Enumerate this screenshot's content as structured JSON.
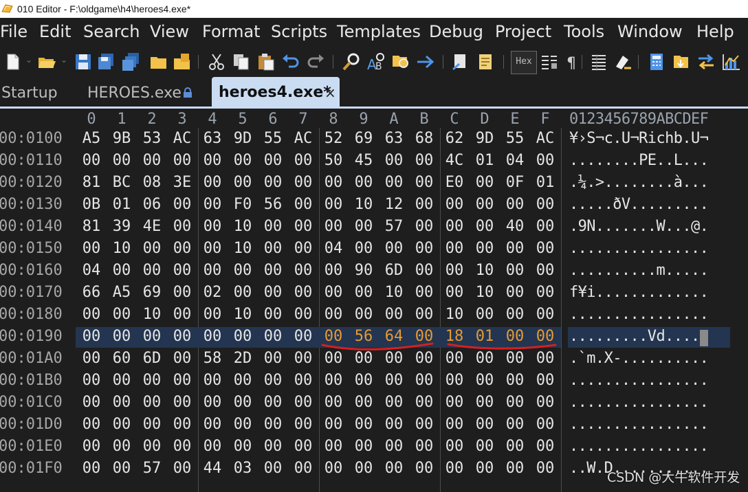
{
  "window": {
    "title": "010 Editor - F:\\oldgame\\h4\\heroes4.exe*"
  },
  "menu": [
    "File",
    "Edit",
    "Search",
    "View",
    "Format",
    "Scripts",
    "Templates",
    "Debug",
    "Project",
    "Tools",
    "Window",
    "Help"
  ],
  "toolbar": {
    "icons": [
      "new-file-icon",
      "open-folder-icon",
      "save-icon",
      "save-as-icon",
      "save-all-icon",
      "open-folder-icon",
      "close-icon",
      "cut-icon",
      "copy-icon",
      "paste-icon",
      "undo-icon",
      "redo-icon",
      "find-icon",
      "replace-icon",
      "find-in-files-icon",
      "goto-icon",
      "compare-icon",
      "notes-icon",
      "hex-mode-icon",
      "binary-view-icon",
      "paragraph-icon",
      "columns-icon",
      "highlight-icon",
      "calculator-icon",
      "inspector-icon",
      "swap-icon",
      "histogram-icon"
    ],
    "hex_label": "Hex"
  },
  "tabs": [
    {
      "label": "Startup",
      "active": false
    },
    {
      "label": "HEROES.exe",
      "active": false,
      "locked": true
    },
    {
      "label": "heroes4.exe*",
      "active": true,
      "close": "×"
    }
  ],
  "hex": {
    "columns": [
      "0",
      "1",
      "2",
      "3",
      "4",
      "5",
      "6",
      "7",
      "8",
      "9",
      "A",
      "B",
      "C",
      "D",
      "E",
      "F"
    ],
    "ascii_header": "0123456789ABCDEF",
    "selected_row": "00:0190",
    "rows": [
      {
        "addr": "00:0100",
        "bytes": [
          "A5",
          "9B",
          "53",
          "AC",
          "63",
          "9D",
          "55",
          "AC",
          "52",
          "69",
          "63",
          "68",
          "62",
          "9D",
          "55",
          "AC"
        ],
        "ascii": "¥›S¬c.U¬Richb.U¬"
      },
      {
        "addr": "00:0110",
        "bytes": [
          "00",
          "00",
          "00",
          "00",
          "00",
          "00",
          "00",
          "00",
          "50",
          "45",
          "00",
          "00",
          "4C",
          "01",
          "04",
          "00"
        ],
        "ascii": "........PE..L..."
      },
      {
        "addr": "00:0120",
        "bytes": [
          "81",
          "BC",
          "08",
          "3E",
          "00",
          "00",
          "00",
          "00",
          "00",
          "00",
          "00",
          "00",
          "E0",
          "00",
          "0F",
          "01"
        ],
        "ascii": ".¼.>........à..."
      },
      {
        "addr": "00:0130",
        "bytes": [
          "0B",
          "01",
          "06",
          "00",
          "00",
          "F0",
          "56",
          "00",
          "00",
          "10",
          "12",
          "00",
          "00",
          "00",
          "00",
          "00"
        ],
        "ascii": ".....ðV........."
      },
      {
        "addr": "00:0140",
        "bytes": [
          "81",
          "39",
          "4E",
          "00",
          "00",
          "10",
          "00",
          "00",
          "00",
          "00",
          "57",
          "00",
          "00",
          "00",
          "40",
          "00"
        ],
        "ascii": ".9N.......W...@."
      },
      {
        "addr": "00:0150",
        "bytes": [
          "00",
          "10",
          "00",
          "00",
          "00",
          "10",
          "00",
          "00",
          "04",
          "00",
          "00",
          "00",
          "00",
          "00",
          "00",
          "00"
        ],
        "ascii": "................"
      },
      {
        "addr": "00:0160",
        "bytes": [
          "04",
          "00",
          "00",
          "00",
          "00",
          "00",
          "00",
          "00",
          "00",
          "90",
          "6D",
          "00",
          "00",
          "10",
          "00",
          "00"
        ],
        "ascii": "..........m....."
      },
      {
        "addr": "00:0170",
        "bytes": [
          "66",
          "A5",
          "69",
          "00",
          "02",
          "00",
          "00",
          "00",
          "00",
          "00",
          "10",
          "00",
          "00",
          "10",
          "00",
          "00"
        ],
        "ascii": "f¥i............."
      },
      {
        "addr": "00:0180",
        "bytes": [
          "00",
          "00",
          "10",
          "00",
          "00",
          "10",
          "00",
          "00",
          "00",
          "00",
          "00",
          "00",
          "10",
          "00",
          "00",
          "00"
        ],
        "ascii": "................"
      },
      {
        "addr": "00:0190",
        "bytes": [
          "00",
          "00",
          "00",
          "00",
          "00",
          "00",
          "00",
          "00",
          "00",
          "56",
          "64",
          "00",
          "18",
          "01",
          "00",
          "00"
        ],
        "ascii": ".........Vd.....",
        "modified": [
          8,
          9,
          10,
          11,
          12,
          13,
          14,
          15
        ]
      },
      {
        "addr": "00:01A0",
        "bytes": [
          "00",
          "60",
          "6D",
          "00",
          "58",
          "2D",
          "00",
          "00",
          "00",
          "00",
          "00",
          "00",
          "00",
          "00",
          "00",
          "00"
        ],
        "ascii": ".`m.X-.........."
      },
      {
        "addr": "00:01B0",
        "bytes": [
          "00",
          "00",
          "00",
          "00",
          "00",
          "00",
          "00",
          "00",
          "00",
          "00",
          "00",
          "00",
          "00",
          "00",
          "00",
          "00"
        ],
        "ascii": "................"
      },
      {
        "addr": "00:01C0",
        "bytes": [
          "00",
          "00",
          "00",
          "00",
          "00",
          "00",
          "00",
          "00",
          "00",
          "00",
          "00",
          "00",
          "00",
          "00",
          "00",
          "00"
        ],
        "ascii": "................"
      },
      {
        "addr": "00:01D0",
        "bytes": [
          "00",
          "00",
          "00",
          "00",
          "00",
          "00",
          "00",
          "00",
          "00",
          "00",
          "00",
          "00",
          "00",
          "00",
          "00",
          "00"
        ],
        "ascii": "................"
      },
      {
        "addr": "00:01E0",
        "bytes": [
          "00",
          "00",
          "00",
          "00",
          "00",
          "00",
          "00",
          "00",
          "00",
          "00",
          "00",
          "00",
          "00",
          "00",
          "00",
          "00"
        ],
        "ascii": "................"
      },
      {
        "addr": "00:01F0",
        "bytes": [
          "00",
          "00",
          "57",
          "00",
          "44",
          "03",
          "00",
          "00",
          "00",
          "00",
          "00",
          "00",
          "00",
          "00",
          "00",
          "00"
        ],
        "ascii": "..W.D..........."
      }
    ]
  },
  "watermark": "CSDN @大牛软件开发",
  "colors": {
    "background": "#1e1e1e",
    "selection": "#233550",
    "modified_byte": "#e59a34",
    "annotation": "#d42020",
    "active_tab": "#c9dcf2"
  }
}
